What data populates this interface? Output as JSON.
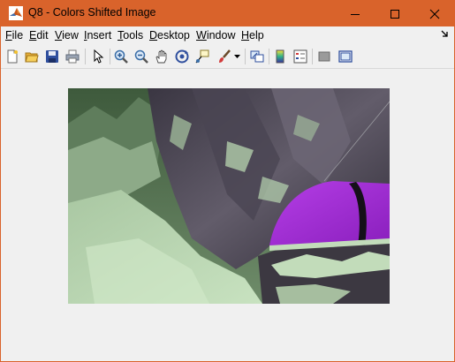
{
  "window": {
    "title": "Q8 - Colors Shifted Image",
    "accent": "#d9632b",
    "controls": [
      "minimize",
      "maximize",
      "close"
    ]
  },
  "menubar": {
    "items": [
      {
        "label": "File",
        "mnemonic": "F",
        "rest": "ile"
      },
      {
        "label": "Edit",
        "mnemonic": "E",
        "rest": "dit"
      },
      {
        "label": "View",
        "mnemonic": "V",
        "rest": "iew"
      },
      {
        "label": "Insert",
        "mnemonic": "I",
        "rest": "nsert"
      },
      {
        "label": "Tools",
        "mnemonic": "T",
        "rest": "ools"
      },
      {
        "label": "Desktop",
        "mnemonic": "D",
        "rest": "esktop"
      },
      {
        "label": "Window",
        "mnemonic": "W",
        "rest": "indow"
      },
      {
        "label": "Help",
        "mnemonic": "H",
        "rest": "elp"
      }
    ]
  },
  "toolbar": {
    "buttons": [
      "new-figure-icon",
      "open-file-icon",
      "save-icon",
      "print-icon",
      "pointer-icon",
      "zoom-in-icon",
      "zoom-out-icon",
      "pan-hand-icon",
      "rotate-3d-icon",
      "data-cursor-icon",
      "brush-icon",
      "brush-dropdown-icon",
      "link-plot-icon",
      "colorbar-icon",
      "legend-icon",
      "hide-plot-tools-icon",
      "show-plot-tools-icon"
    ]
  },
  "image": {
    "description_colors": {
      "sky": "#4d6d4a",
      "rock": "#5a5560",
      "snow": "#b8d6b0",
      "tent": "#a02cd8"
    }
  }
}
